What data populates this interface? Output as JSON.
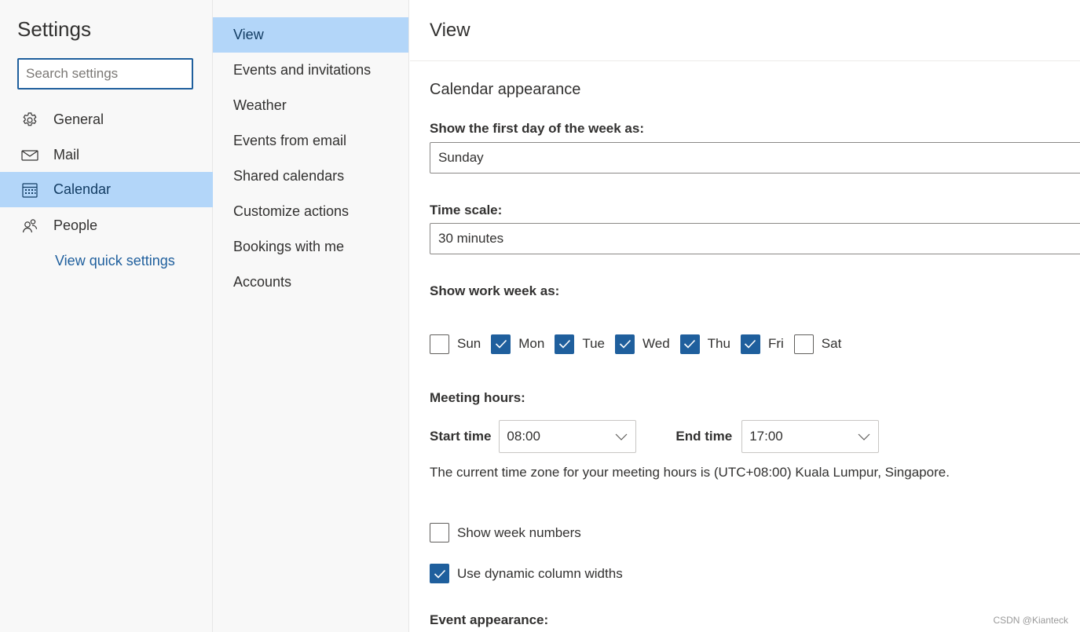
{
  "settings": {
    "title": "Settings",
    "search_placeholder": "Search settings",
    "nav": [
      {
        "label": "General",
        "icon": "gear-icon"
      },
      {
        "label": "Mail",
        "icon": "mail-icon"
      },
      {
        "label": "Calendar",
        "icon": "calendar-icon",
        "active": true
      },
      {
        "label": "People",
        "icon": "people-icon"
      }
    ],
    "quick_settings": "View quick settings"
  },
  "calendar_nav": [
    {
      "label": "View",
      "active": true
    },
    {
      "label": "Events and invitations"
    },
    {
      "label": "Weather"
    },
    {
      "label": "Events from email"
    },
    {
      "label": "Shared calendars"
    },
    {
      "label": "Customize actions"
    },
    {
      "label": "Bookings with me"
    },
    {
      "label": "Accounts"
    }
  ],
  "main": {
    "title": "View",
    "section_title": "Calendar appearance",
    "first_day_label": "Show the first day of the week as:",
    "first_day_value": "Sunday",
    "time_scale_label": "Time scale:",
    "time_scale_value": "30 minutes",
    "work_week_label": "Show work week as:",
    "days": [
      {
        "label": "Sun",
        "checked": false
      },
      {
        "label": "Mon",
        "checked": true
      },
      {
        "label": "Tue",
        "checked": true
      },
      {
        "label": "Wed",
        "checked": true
      },
      {
        "label": "Thu",
        "checked": true
      },
      {
        "label": "Fri",
        "checked": true
      },
      {
        "label": "Sat",
        "checked": false
      }
    ],
    "meeting_hours_label": "Meeting hours:",
    "start_time_label": "Start time",
    "start_time_value": "08:00",
    "end_time_label": "End time",
    "end_time_value": "17:00",
    "timezone_note": "The current time zone for your meeting hours is (UTC+08:00) Kuala Lumpur, Singapore.",
    "show_week_numbers_label": "Show week numbers",
    "show_week_numbers": false,
    "dynamic_columns_label": "Use dynamic column widths",
    "dynamic_columns": true,
    "event_appearance_label": "Event appearance:"
  },
  "watermark": "CSDN @Kianteck",
  "colors": {
    "accent": "#1f5f9d",
    "selected_bg": "#b3d6f9",
    "pane_bg": "#f8f8f8"
  }
}
